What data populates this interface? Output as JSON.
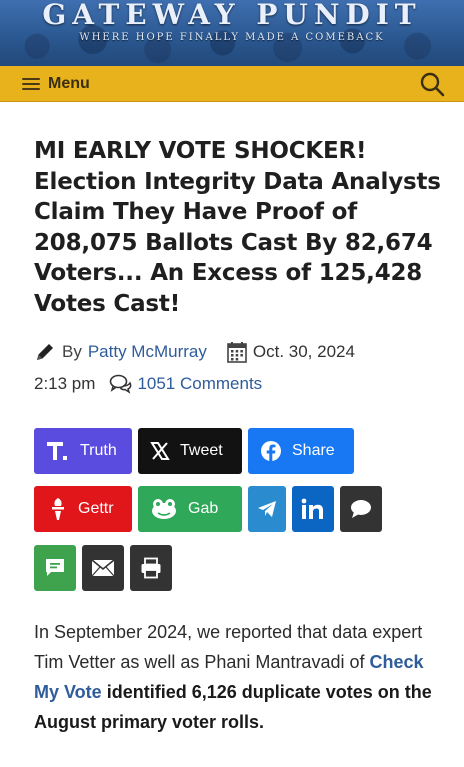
{
  "site": {
    "logo": "GATEWAY PUNDIT",
    "tagline": "WHERE HOPE FINALLY MADE A COMEBACK"
  },
  "menubar": {
    "menu_label": "Menu",
    "color": "#e8b21c"
  },
  "article": {
    "headline": "MI EARLY VOTE SHOCKER! Election Integrity Data Analysts Claim They Have Proof of 208,075 Ballots Cast By 82,674 Voters... An Excess of 125,428 Votes Cast!",
    "by_label": "By",
    "author": "Patty McMurray",
    "date": "Oct. 30, 2024",
    "time": "2:13 pm",
    "comments": "1051 Comments"
  },
  "share": {
    "truth": {
      "label": "Truth",
      "color": "#5b4ce0"
    },
    "tweet": {
      "label": "Tweet",
      "color": "#121212"
    },
    "facebook": {
      "label": "Share",
      "color": "#1877f2"
    },
    "gettr": {
      "label": "Gettr",
      "color": "#e0161b"
    },
    "gab": {
      "label": "Gab",
      "color": "#2fa85a"
    },
    "telegram": {
      "icon": "telegram-icon",
      "color": "#2a8ccf"
    },
    "linkedin": {
      "icon": "linkedin-icon",
      "color": "#0a66c2"
    },
    "comment": {
      "icon": "speech-bubble-icon",
      "color": "#333333"
    },
    "sms": {
      "icon": "sms-icon",
      "color": "#3fa34d"
    },
    "email": {
      "icon": "envelope-icon",
      "color": "#333333"
    },
    "print": {
      "icon": "printer-icon",
      "color": "#333333"
    }
  },
  "body": {
    "p1_part1": "In September 2024, we reported that data expert Tim Vetter as well as Phani Mantravadi of ",
    "p1_link": "Check My Vote",
    "p1_bold": "identified 6,126 duplicate votes on the August primary voter rolls."
  }
}
